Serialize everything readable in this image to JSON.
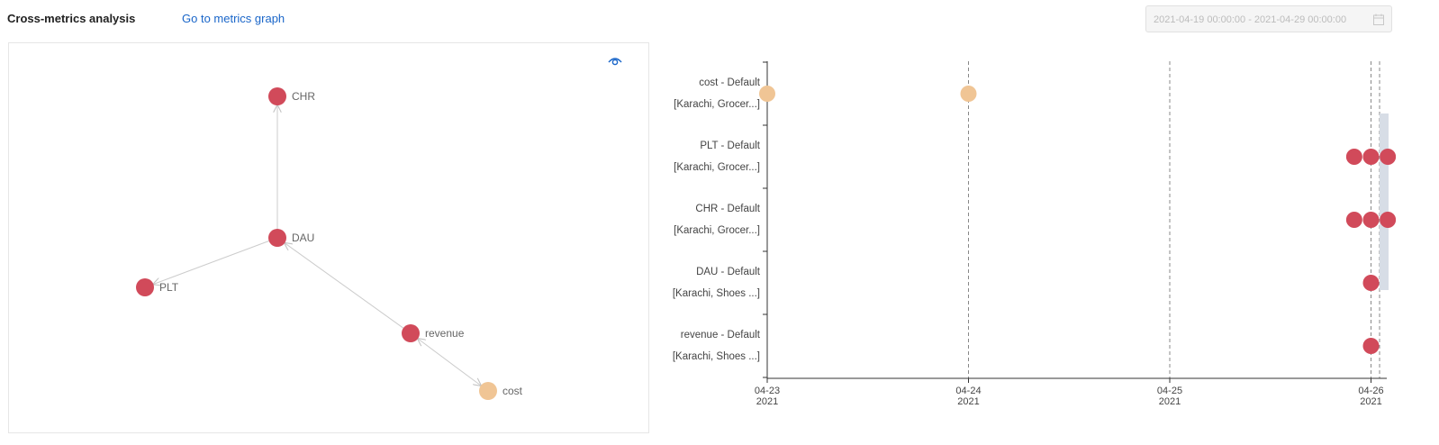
{
  "header": {
    "title": "Cross-metrics analysis",
    "graph_link": "Go to metrics graph",
    "date_range": "2021-04-19 00:00:00 - 2021-04-29 00:00:00"
  },
  "colors": {
    "alert_node": "#d14a5a",
    "secondary_node": "#f0c595",
    "edge": "#cccccc",
    "link": "#1a66c9"
  },
  "graph": {
    "nodes": [
      {
        "id": "CHR",
        "label": "CHR",
        "color": "alert_node"
      },
      {
        "id": "DAU",
        "label": "DAU",
        "color": "alert_node"
      },
      {
        "id": "PLT",
        "label": "PLT",
        "color": "alert_node"
      },
      {
        "id": "revenue",
        "label": "revenue",
        "color": "alert_node"
      },
      {
        "id": "cost",
        "label": "cost",
        "color": "secondary_node"
      }
    ],
    "edges": [
      {
        "from": "DAU",
        "to": "CHR",
        "bidirectional": false
      },
      {
        "from": "DAU",
        "to": "PLT",
        "bidirectional": false
      },
      {
        "from": "revenue",
        "to": "DAU",
        "bidirectional": false
      },
      {
        "from": "revenue",
        "to": "cost",
        "bidirectional": true
      }
    ]
  },
  "timeline": {
    "rows": [
      {
        "metric": "cost - Default",
        "dims": "[Karachi, Grocer...]"
      },
      {
        "metric": "PLT - Default",
        "dims": "[Karachi, Grocer...]"
      },
      {
        "metric": "CHR - Default",
        "dims": "[Karachi, Grocer...]"
      },
      {
        "metric": "DAU - Default",
        "dims": "[Karachi, Shoes ...]"
      },
      {
        "metric": "revenue - Default",
        "dims": "[Karachi, Shoes ...]"
      }
    ],
    "x_ticks": [
      {
        "md": "04-23",
        "year": "2021"
      },
      {
        "md": "04-24",
        "year": "2021"
      },
      {
        "md": "04-25",
        "year": "2021"
      },
      {
        "md": "04-26",
        "year": "2021"
      }
    ]
  },
  "chart_data": {
    "type": "scatter",
    "xlim": [
      "2021-04-23",
      "2021-04-26 10:00"
    ],
    "categories": [
      "cost - Default [Karachi, Grocer...]",
      "PLT - Default [Karachi, Grocer...]",
      "CHR - Default [Karachi, Grocer...]",
      "DAU - Default [Karachi, Shoes ...]",
      "revenue - Default [Karachi, Shoes ...]"
    ],
    "series": [
      {
        "row": 0,
        "color": "secondary_node",
        "x": [
          "2021-04-23 00:00",
          "2021-04-24 00:00"
        ]
      },
      {
        "row": 1,
        "color": "alert_node",
        "x": [
          "2021-04-25 22:00",
          "2021-04-26 00:00",
          "2021-04-26 02:00"
        ]
      },
      {
        "row": 2,
        "color": "alert_node",
        "x": [
          "2021-04-25 22:00",
          "2021-04-26 00:00",
          "2021-04-26 02:00"
        ]
      },
      {
        "row": 3,
        "color": "alert_node",
        "x": [
          "2021-04-26 00:00"
        ]
      },
      {
        "row": 4,
        "color": "alert_node",
        "x": [
          "2021-04-26 00:00"
        ]
      }
    ],
    "grid": "vertical dashed at day ticks",
    "legend": "none"
  }
}
